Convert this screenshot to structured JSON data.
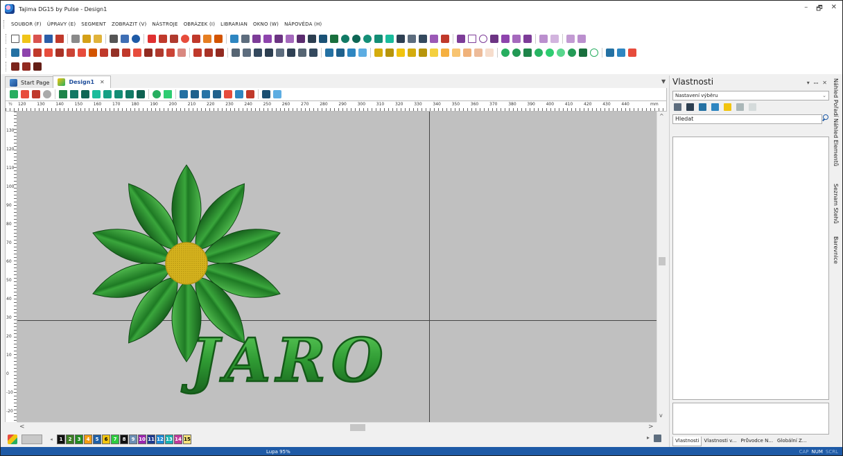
{
  "window": {
    "title": "Tajima DG15 by Pulse - Design1",
    "controls": [
      "–",
      "🗗",
      "✕"
    ]
  },
  "menu": [
    "SOUBOR (F)",
    "ÚPRAVY (E)",
    "SEGMENT",
    "ZOBRAZIT (V)",
    "NÁSTROJE",
    "OBRÁZEK (I)",
    "LIBRARIAN",
    "OKNO (W)",
    "NÁPOVĚDA (H)"
  ],
  "doc_tabs": {
    "start": "Start Page",
    "design": "Design1",
    "close": "✕",
    "dropdown": "▼"
  },
  "ruler": {
    "unit_symbol": "½",
    "labels": [
      "120",
      "130",
      "140",
      "150",
      "160",
      "170",
      "180",
      "190",
      "200",
      "210",
      "220",
      "230",
      "240",
      "250",
      "260",
      "270",
      "280",
      "290",
      "300",
      "310",
      "320",
      "330",
      "340",
      "350",
      "360",
      "370",
      "380",
      "390",
      "400",
      "410",
      "420",
      "430",
      "440"
    ],
    "unit": "mm",
    "v_labels": [
      "130",
      "120",
      "110",
      "100",
      "90",
      "80",
      "70",
      "60",
      "50",
      "40",
      "30",
      "20",
      "10",
      "0",
      "-10",
      "-20"
    ]
  },
  "design": {
    "text": "JARO",
    "flower_colors": {
      "petal_dark": "#16601c",
      "petal_mid": "#2f9a33",
      "petal_light": "#5cc35b",
      "center": "#e6c321",
      "center_dark": "#b59713"
    }
  },
  "palette": {
    "swatches": [
      {
        "n": "1",
        "color": "#111111"
      },
      {
        "n": "2",
        "color": "#3b7d23"
      },
      {
        "n": "3",
        "color": "#228b22"
      },
      {
        "n": "4",
        "color": "#f39c12"
      },
      {
        "n": "5",
        "color": "#1f5fa6"
      },
      {
        "n": "6",
        "color": "#f1c40f"
      },
      {
        "n": "7",
        "color": "#2ecc40"
      },
      {
        "n": "8",
        "color": "#111111"
      },
      {
        "n": "9",
        "color": "#6c8fb5"
      },
      {
        "n": "10",
        "color": "#9b27b0"
      },
      {
        "n": "11",
        "color": "#1f3b8f"
      },
      {
        "n": "12",
        "color": "#1e8ad6"
      },
      {
        "n": "13",
        "color": "#17b3b3"
      },
      {
        "n": "14",
        "color": "#c0399b"
      },
      {
        "n": "15",
        "color": "#f7e27a"
      }
    ],
    "nav_left": "◂"
  },
  "status": {
    "zoom": "Lupa 95%",
    "indicators": [
      "CAP",
      "NUM",
      "SCRL"
    ]
  },
  "properties": {
    "title": "Vlastnosti",
    "ctrls": [
      "▾",
      "ꟷ",
      "✕"
    ],
    "select": "Nastavení výběru",
    "search_placeholder": "Hledat",
    "bottom_tabs": [
      "Vlastnosti",
      "Vlastnosti v...",
      "Průvodce N...",
      "Globální Z..."
    ]
  },
  "side_tabs": [
    "Náhled Pořadí",
    "Náhled Elementů",
    "Seznam Stehů",
    "Barevnice"
  ]
}
